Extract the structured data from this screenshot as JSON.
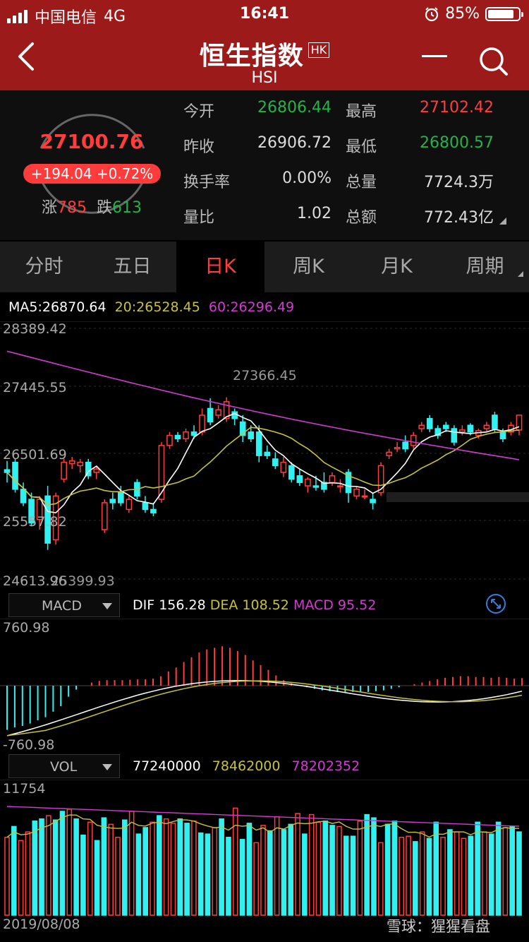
{
  "status": {
    "carrier": "中国电信",
    "network": "4G",
    "time": "16:41",
    "battery": "85%",
    "battery_level": 0.85
  },
  "header": {
    "title": "恒生指数",
    "badge": "HK",
    "subtitle": "HSI"
  },
  "quote": {
    "price": "27100.76",
    "change": "+194.04",
    "change_pct": "+0.72%",
    "up_label": "涨",
    "up_count": "785",
    "down_label": "跌",
    "down_count": "613",
    "rows": [
      {
        "l1": "今开",
        "v1": "26806.44",
        "l2": "最高",
        "v2": "27102.42"
      },
      {
        "l1": "昨收",
        "v1": "26906.72",
        "l2": "最低",
        "v2": "26800.57"
      },
      {
        "l1": "换手率",
        "v1": "0.00%",
        "l2": "总量",
        "v2": "7724.3万"
      },
      {
        "l1": "量比",
        "v1": "1.02",
        "l2": "总额",
        "v2": "772.43亿"
      }
    ]
  },
  "tabs": [
    "分时",
    "五日",
    "日K",
    "周K",
    "月K",
    "周期"
  ],
  "active_tab": "日K",
  "kline": {
    "ma5": "MA5:26870.64",
    "ma20": "20:26528.45",
    "ma60": "60:26296.49",
    "y_ticks": [
      "28389.42",
      "27445.55",
      "26501.69",
      "25557.82",
      "24613.96"
    ],
    "high_label": "27366.45",
    "low_label": "25399.93"
  },
  "macd": {
    "selector": "MACD",
    "dif": "DIF 156.28",
    "dea": "DEA 108.52",
    "macd": "MACD 95.52",
    "y_top": "760.98",
    "y_bottom": "-760.98"
  },
  "vol": {
    "selector": "VOL",
    "v1": "77240000",
    "v2": "78462000",
    "v3": "78202352",
    "y_top": "11754",
    "date_start": "2019/08/08"
  },
  "watermark": "雪球：猩猩看盘",
  "colors": {
    "up": "#ff3d3d",
    "down": "#30f0f0",
    "ma5": "#ffffff",
    "ma20": "#c7c23a",
    "ma60": "#d23ad2",
    "header": "#9c1a1a"
  },
  "chart_data": [
    {
      "type": "candlestick",
      "title": "恒生指数 日K",
      "ylim": [
        24613.96,
        28389.42
      ],
      "candles": [
        {
          "o": 26290,
          "h": 26420,
          "l": 26100,
          "c": 26250
        },
        {
          "o": 26400,
          "h": 26450,
          "l": 25950,
          "c": 26000
        },
        {
          "o": 26000,
          "h": 26100,
          "l": 25750,
          "c": 25800
        },
        {
          "o": 25850,
          "h": 25950,
          "l": 25450,
          "c": 25500
        },
        {
          "o": 25550,
          "h": 25900,
          "l": 25400,
          "c": 25850
        },
        {
          "o": 25900,
          "h": 26050,
          "l": 25100,
          "c": 25200
        },
        {
          "o": 25250,
          "h": 25950,
          "l": 25180,
          "c": 25900
        },
        {
          "o": 26150,
          "h": 26450,
          "l": 26100,
          "c": 26400
        },
        {
          "o": 26380,
          "h": 26480,
          "l": 26300,
          "c": 26420
        },
        {
          "o": 26350,
          "h": 26450,
          "l": 26250,
          "c": 26400
        },
        {
          "o": 26400,
          "h": 26450,
          "l": 26150,
          "c": 26200
        },
        {
          "o": 26250,
          "h": 26350,
          "l": 26150,
          "c": 26300
        },
        {
          "o": 25400,
          "h": 25850,
          "l": 25350,
          "c": 25800
        },
        {
          "o": 25850,
          "h": 25950,
          "l": 25700,
          "c": 25800
        },
        {
          "o": 25950,
          "h": 26050,
          "l": 25750,
          "c": 25800
        },
        {
          "o": 25700,
          "h": 25900,
          "l": 25650,
          "c": 25850
        },
        {
          "o": 26100,
          "h": 26150,
          "l": 25850,
          "c": 25900
        },
        {
          "o": 25800,
          "h": 25900,
          "l": 25650,
          "c": 25700
        },
        {
          "o": 25700,
          "h": 25800,
          "l": 25600,
          "c": 25650
        },
        {
          "o": 25850,
          "h": 26700,
          "l": 25800,
          "c": 26650
        },
        {
          "o": 26650,
          "h": 26850,
          "l": 26600,
          "c": 26800
        },
        {
          "o": 26800,
          "h": 26850,
          "l": 26700,
          "c": 26750
        },
        {
          "o": 26750,
          "h": 26900,
          "l": 26700,
          "c": 26850
        },
        {
          "o": 26850,
          "h": 26950,
          "l": 26750,
          "c": 26800
        },
        {
          "o": 26850,
          "h": 27200,
          "l": 26800,
          "c": 27100
        },
        {
          "o": 27200,
          "h": 27350,
          "l": 26950,
          "c": 27000
        },
        {
          "o": 27100,
          "h": 27250,
          "l": 27050,
          "c": 27180
        },
        {
          "o": 27050,
          "h": 27366,
          "l": 27000,
          "c": 27300
        },
        {
          "o": 27150,
          "h": 27200,
          "l": 26950,
          "c": 27050
        },
        {
          "o": 27000,
          "h": 27100,
          "l": 26700,
          "c": 26800
        },
        {
          "o": 26850,
          "h": 26950,
          "l": 26700,
          "c": 26750
        },
        {
          "o": 26850,
          "h": 26950,
          "l": 26400,
          "c": 26500
        },
        {
          "o": 26550,
          "h": 26650,
          "l": 26450,
          "c": 26500
        },
        {
          "o": 26450,
          "h": 26550,
          "l": 26300,
          "c": 26350
        },
        {
          "o": 26250,
          "h": 26480,
          "l": 26180,
          "c": 26400
        },
        {
          "o": 26350,
          "h": 26400,
          "l": 26100,
          "c": 26150
        },
        {
          "o": 26200,
          "h": 26300,
          "l": 26050,
          "c": 26100
        },
        {
          "o": 26050,
          "h": 26180,
          "l": 25950,
          "c": 26150
        },
        {
          "o": 26050,
          "h": 26200,
          "l": 25980,
          "c": 26030
        },
        {
          "o": 26100,
          "h": 26250,
          "l": 25950,
          "c": 26000
        },
        {
          "o": 26100,
          "h": 26250,
          "l": 26050,
          "c": 26200
        },
        {
          "o": 26050,
          "h": 26150,
          "l": 25950,
          "c": 26050
        },
        {
          "o": 26250,
          "h": 26300,
          "l": 25800,
          "c": 25950
        },
        {
          "o": 25900,
          "h": 26050,
          "l": 25850,
          "c": 26000
        },
        {
          "o": 25900,
          "h": 26000,
          "l": 25850,
          "c": 25900
        },
        {
          "o": 25850,
          "h": 25950,
          "l": 25700,
          "c": 25800
        },
        {
          "o": 25950,
          "h": 26400,
          "l": 25900,
          "c": 26350
        },
        {
          "o": 26500,
          "h": 26600,
          "l": 26450,
          "c": 26550
        },
        {
          "o": 26600,
          "h": 26700,
          "l": 26550,
          "c": 26620
        },
        {
          "o": 26700,
          "h": 26800,
          "l": 26550,
          "c": 26600
        },
        {
          "o": 26650,
          "h": 26850,
          "l": 26600,
          "c": 26800
        },
        {
          "o": 26900,
          "h": 27000,
          "l": 26850,
          "c": 26950
        },
        {
          "o": 27050,
          "h": 27100,
          "l": 26850,
          "c": 26900
        },
        {
          "o": 26900,
          "h": 26950,
          "l": 26750,
          "c": 26800
        },
        {
          "o": 26950,
          "h": 27000,
          "l": 26850,
          "c": 26900
        },
        {
          "o": 26900,
          "h": 26950,
          "l": 26650,
          "c": 26700
        },
        {
          "o": 26850,
          "h": 26950,
          "l": 26800,
          "c": 26880
        },
        {
          "o": 26950,
          "h": 26980,
          "l": 26800,
          "c": 26850
        },
        {
          "o": 26800,
          "h": 26900,
          "l": 26750,
          "c": 26870
        },
        {
          "o": 26900,
          "h": 27000,
          "l": 26850,
          "c": 26950
        },
        {
          "o": 27100,
          "h": 27150,
          "l": 26850,
          "c": 26900
        },
        {
          "o": 26850,
          "h": 26900,
          "l": 26700,
          "c": 26750
        },
        {
          "o": 26850,
          "h": 27000,
          "l": 26800,
          "c": 26950
        },
        {
          "o": 26880,
          "h": 27102,
          "l": 26800,
          "c": 27100
        }
      ]
    },
    {
      "type": "bar",
      "title": "MACD",
      "ylim": [
        -760.98,
        760.98
      ],
      "values": [
        -560,
        -530,
        -510,
        -480,
        -440,
        -400,
        -330,
        -260,
        -140,
        -50,
        0,
        40,
        60,
        70,
        70,
        70,
        75,
        80,
        80,
        90,
        120,
        180,
        230,
        300,
        360,
        420,
        460,
        480,
        500,
        480,
        440,
        390,
        320,
        260,
        200,
        130,
        70,
        30,
        0,
        -20,
        -40,
        -60,
        -70,
        -80,
        -80,
        -80,
        -80,
        -80,
        -70,
        -60,
        -40,
        -20,
        0,
        20,
        40,
        60,
        80,
        100,
        110,
        120,
        120,
        110,
        110,
        100,
        110,
        100,
        90,
        95.52
      ]
    },
    {
      "type": "bar",
      "title": "VOL",
      "values": [
        7200,
        8200,
        6900,
        7700,
        8700,
        8900,
        9200,
        8800,
        9600,
        9800,
        8900,
        7400,
        8600,
        6900,
        9000,
        8400,
        7200,
        8800,
        9600,
        7500,
        8100,
        8600,
        9200,
        8900,
        8500,
        8900,
        8500,
        8700,
        7600,
        7500,
        8100,
        8900,
        7200,
        9900,
        7000,
        8500,
        6700,
        8300,
        7800,
        9100,
        7900,
        8400,
        9400,
        7500,
        9300,
        8600,
        8700,
        8300,
        8200,
        7300,
        7300,
        8700,
        9300,
        9000,
        6700,
        8400,
        8700,
        7200,
        7300,
        6800,
        7700,
        7100,
        8600,
        7200,
        7900,
        7700,
        7100,
        7300,
        8600,
        7700,
        7500,
        8600,
        8100,
        8200,
        7700
      ]
    }
  ]
}
